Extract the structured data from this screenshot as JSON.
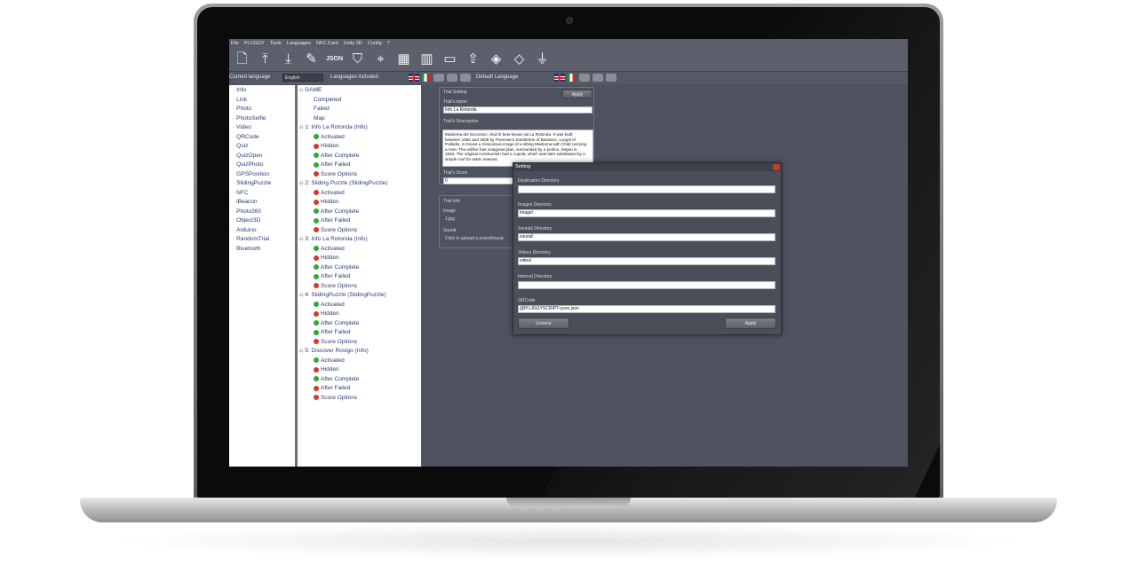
{
  "menu": [
    "File",
    "PLUGGY",
    "Tools",
    "Languages",
    "NFC Card",
    "Unity 3D",
    "Config",
    "?"
  ],
  "toolbar_icons": [
    "new-file-icon",
    "upload-file-icon",
    "download-file-icon",
    "edit-icon",
    "json-icon",
    "shield-check-icon",
    "map-pin-icon",
    "qrcode-icon",
    "map-icon",
    "mobile-icon",
    "cloud-upload-icon",
    "package-icon",
    "unity-icon",
    "usb-icon"
  ],
  "toolbar_json_label": "JSON",
  "langbar": {
    "current_language_label": "Current language",
    "current_language_value": "English",
    "languages_included_label": "Languages included",
    "default_language_label": "Default Language"
  },
  "left_list": [
    "Info",
    "Link",
    "Photo",
    "PhotoSelfie",
    "Video",
    "QRCode",
    "Quiz",
    "QuizOpen",
    "QuizPhoto",
    "GPSPosition",
    "SlidingPuzzle",
    "NFC",
    "iBeacon",
    "Photo360",
    "Object3D",
    "Arduino",
    "RandomTrial",
    "Bluetooth"
  ],
  "tree": {
    "root": "GAME",
    "root_children": [
      "Completed",
      "Failed",
      "Map"
    ],
    "groups": [
      {
        "title": "1: Info La Rotonda (Info)",
        "items": [
          {
            "label": "Activated",
            "state": "ok"
          },
          {
            "label": "Hidden",
            "state": "no"
          },
          {
            "label": "After Complete",
            "state": "ok"
          },
          {
            "label": "After Failed",
            "state": "ok"
          },
          {
            "label": "Score Options",
            "state": "no"
          }
        ]
      },
      {
        "title": "2: Sliding Puzzle (SlidingPuzzle)",
        "items": [
          {
            "label": "Activated",
            "state": "no"
          },
          {
            "label": "Hidden",
            "state": "no"
          },
          {
            "label": "After Complete",
            "state": "ok"
          },
          {
            "label": "After Failed",
            "state": "ok"
          },
          {
            "label": "Score Options",
            "state": "no"
          }
        ]
      },
      {
        "title": "3: Info La Rotonda (Info)",
        "items": [
          {
            "label": "Activated",
            "state": "ok"
          },
          {
            "label": "Hidden",
            "state": "no"
          },
          {
            "label": "After Complete",
            "state": "ok"
          },
          {
            "label": "After Failed",
            "state": "ok"
          },
          {
            "label": "Score Options",
            "state": "no"
          }
        ]
      },
      {
        "title": "4: SlidingPuzzle (SlidingPuzzle)",
        "items": [
          {
            "label": "Activated",
            "state": "ok"
          },
          {
            "label": "Hidden",
            "state": "no"
          },
          {
            "label": "After Complete",
            "state": "ok"
          },
          {
            "label": "After Failed",
            "state": "ok"
          },
          {
            "label": "Score Options",
            "state": "no"
          }
        ]
      },
      {
        "title": "5: Discover Rovigo (Info)",
        "items": [
          {
            "label": "Activated",
            "state": "ok"
          },
          {
            "label": "Hidden",
            "state": "no"
          },
          {
            "label": "After Complete",
            "state": "ok"
          },
          {
            "label": "After Failed",
            "state": "no"
          },
          {
            "label": "Score Options",
            "state": "no"
          }
        ]
      }
    ]
  },
  "trial": {
    "setting_label": "Trial Setting",
    "apply_label": "Apply",
    "name_label": "Trial's name",
    "name_value": "Info La Rotonda",
    "description_label": "Trial's Description",
    "description_value": "Madonna del Soccorso: church best known as La Rotonda. It was built between 1594 and 1606 by Francesco Zamberlan of Bassano, a pupil of Palladio, to house a miraculous image of a sitting Madonna with Child carrying a rose. The edifice has octagonal plan, surrounded by a portico, begun in 1594. The original construction had a cupola, which was later substituted by a simple roof for static reasons.",
    "score_label": "Trial's Score",
    "score_value": "0",
    "info_label": "Trial Info",
    "image_label": "Image",
    "image_value": "1.jpg",
    "sound_label": "Sound",
    "sound_value": "Click to upload a sound/music"
  },
  "setting_dialog": {
    "title": "Setting",
    "fields": [
      {
        "label": "Destination Directory",
        "value": ""
      },
      {
        "label": "Images Directory",
        "value": "image/"
      },
      {
        "label": "Sounds Directory",
        "value": "sound/"
      },
      {
        "label": "Videos Directory",
        "value": "video/"
      },
      {
        "label": "Internal Directory",
        "value": ""
      },
      {
        "label": "QRCode",
        "value": "@PLUGGYSCRIPT+json.json"
      }
    ],
    "licence_label": "Licence",
    "apply_label": "Apply"
  },
  "colors": {
    "ok": "#2fa836",
    "no": "#d23a2a",
    "tree_text": "#2a3b74",
    "app_bg": "#4e535f"
  }
}
